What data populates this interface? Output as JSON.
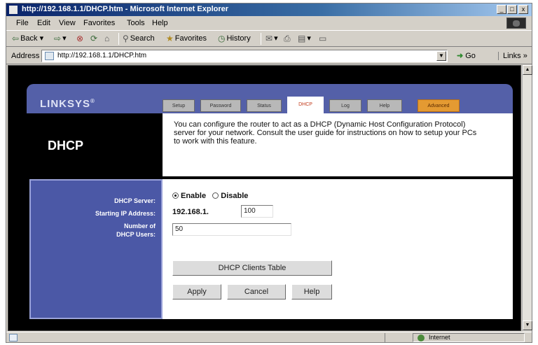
{
  "window": {
    "title": "http://192.168.1.1/DHCP.htm - Microsoft Internet Explorer",
    "controls": [
      "_",
      "□",
      "x"
    ]
  },
  "menu": [
    "File",
    "Edit",
    "View",
    "Favorites",
    "Tools",
    "Help"
  ],
  "toolbar": {
    "back": "Back",
    "search": "Search",
    "favorites": "Favorites",
    "history": "History"
  },
  "address": {
    "label": "Address",
    "url": "http://192.168.1.1/DHCP.htm",
    "go": "Go",
    "links": "Links"
  },
  "linksys": {
    "logo": "LINKSYS",
    "logo_mark": "®",
    "tabs": [
      {
        "label": "Setup",
        "active": false
      },
      {
        "label": "Password",
        "active": false
      },
      {
        "label": "Status",
        "active": false
      },
      {
        "label": "DHCP",
        "active": true
      },
      {
        "label": "Log",
        "active": false
      },
      {
        "label": "Help",
        "active": false
      },
      {
        "label": "Advanced",
        "active": false
      }
    ],
    "page_title": "DHCP",
    "intro": "You can configure the router to act as a DHCP (Dynamic Host Configuration Protocol) server for your network. Consult the user guide for instructions on how to setup your PCs to work with this feature."
  },
  "form": {
    "dhcp_server_label": "DHCP Server:",
    "enable_label": "Enable",
    "disable_label": "Disable",
    "enabled": true,
    "start_ip_label": "Starting IP Address:",
    "ip_prefix": "192.168.1.",
    "start_ip_last": "100",
    "num_users_label_1": "Number of",
    "num_users_label_2": "DHCP Users:",
    "num_users": "50",
    "clients_table_button": "DHCP Clients Table",
    "apply_button": "Apply",
    "cancel_button": "Cancel",
    "help_button": "Help"
  },
  "status": {
    "zone": "Internet"
  },
  "colors": {
    "title_bar": "#0a246a",
    "linksys_blue": "#5460a8",
    "form_panel": "#4b58a6",
    "advanced_tab": "#e49a32",
    "active_tab_text": "#c23a1a"
  }
}
